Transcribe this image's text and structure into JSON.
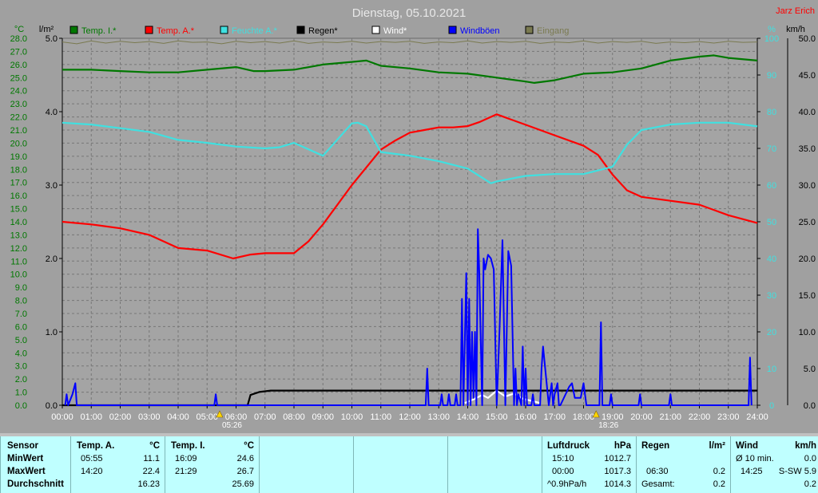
{
  "chart_data": {
    "type": "line",
    "title": "Dienstag, 05.10.2021",
    "author": "Jarz Erich",
    "axes": {
      "temp_unit": "°C",
      "temp_min": 0,
      "temp_max": 28,
      "rain_unit": "l/m²",
      "rain_min": 0,
      "rain_max": 5,
      "hum_unit": "%",
      "hum_min": 0,
      "hum_max": 100,
      "wind_unit": "km/h",
      "wind_min": 0,
      "wind_max": 50
    },
    "x_ticks": [
      "00:00",
      "01:00",
      "02:00",
      "03:00",
      "04:00",
      "05:00",
      "06:00",
      "07:00",
      "08:00",
      "09:00",
      "10:00",
      "11:00",
      "12:00",
      "13:00",
      "14:00",
      "15:00",
      "16:00",
      "17:00",
      "18:00",
      "19:00",
      "20:00",
      "21:00",
      "22:00",
      "23:00",
      "24:00"
    ],
    "temp_ticks": [
      "0.0",
      "1.0",
      "2.0",
      "3.0",
      "4.0",
      "5.0",
      "6.0",
      "7.0",
      "8.0",
      "9.0",
      "10.0",
      "11.0",
      "12.0",
      "13.0",
      "14.0",
      "15.0",
      "16.0",
      "17.0",
      "18.0",
      "19.0",
      "20.0",
      "21.0",
      "22.0",
      "23.0",
      "24.0",
      "25.0",
      "26.0",
      "27.0",
      "28.0"
    ],
    "rain_ticks": [
      "0.0",
      "1.0",
      "2.0",
      "3.0",
      "4.0",
      "5.0"
    ],
    "hum_ticks": [
      "0",
      "10",
      "20",
      "30",
      "40",
      "50",
      "60",
      "70",
      "80",
      "90",
      "100"
    ],
    "wind_ticks": [
      "0.0",
      "5.0",
      "10.0",
      "15.0",
      "20.0",
      "25.0",
      "30.0",
      "35.0",
      "40.0",
      "45.0",
      "50.0"
    ],
    "legend": [
      {
        "name": "Temp. I.*",
        "color": "#007800"
      },
      {
        "name": "Temp. A.*",
        "color": "#ff0000"
      },
      {
        "name": "Feuchte A.*",
        "color": "#40e0e0"
      },
      {
        "name": "Regen*",
        "color": "#000000"
      },
      {
        "name": "Wind*",
        "color": "#ffffff"
      },
      {
        "name": "Windböen",
        "color": "#0000ff"
      },
      {
        "name": "Eingang",
        "color": "#7a7a50"
      }
    ],
    "sunrise": "05:26",
    "sunset": "18:26",
    "series": [
      {
        "name": "Temp. I.*",
        "axis": "temp",
        "color": "#007800",
        "x": [
          0,
          1,
          2,
          3,
          4,
          5,
          6,
          6.6,
          7,
          8,
          9,
          10,
          10.5,
          11,
          12,
          13,
          14,
          15,
          16,
          16.3,
          17,
          18,
          19,
          20,
          21,
          22,
          22.5,
          23,
          24
        ],
        "y": [
          25.6,
          25.6,
          25.5,
          25.4,
          25.4,
          25.6,
          25.8,
          25.5,
          25.5,
          25.6,
          26.0,
          26.2,
          26.3,
          25.9,
          25.7,
          25.4,
          25.3,
          25.0,
          24.7,
          24.6,
          24.8,
          25.3,
          25.4,
          25.7,
          26.3,
          26.6,
          26.7,
          26.5,
          26.3
        ]
      },
      {
        "name": "Temp. A.*",
        "axis": "temp",
        "color": "#ff0000",
        "x": [
          0,
          1,
          2,
          3,
          4,
          5,
          5.9,
          6.5,
          7,
          8,
          8.5,
          9,
          10,
          11,
          11.5,
          12,
          12.5,
          13,
          13.5,
          14,
          14.4,
          15,
          15.5,
          16,
          17,
          18,
          18.5,
          19,
          19.5,
          20,
          21,
          22,
          23,
          24
        ],
        "y": [
          14.0,
          13.8,
          13.5,
          13.0,
          12.0,
          11.8,
          11.2,
          11.5,
          11.6,
          11.6,
          12.5,
          13.8,
          16.8,
          19.5,
          20.2,
          20.8,
          21.0,
          21.2,
          21.2,
          21.3,
          21.6,
          22.2,
          21.8,
          21.4,
          20.6,
          19.8,
          19.1,
          17.6,
          16.4,
          15.9,
          15.6,
          15.3,
          14.5,
          13.9
        ]
      },
      {
        "name": "Feuchte A.*",
        "axis": "hum",
        "color": "#40e0e0",
        "x": [
          0,
          1,
          2,
          3,
          4,
          5,
          6,
          7,
          7.5,
          8,
          9,
          10,
          10.2,
          10.5,
          11,
          12,
          13,
          14,
          14.8,
          15,
          16,
          17,
          18,
          19,
          19.5,
          20,
          21,
          22,
          23,
          24
        ],
        "y": [
          77,
          76.5,
          75.5,
          74.5,
          72.3,
          71.5,
          70.5,
          70,
          70.3,
          71.5,
          68,
          76.8,
          77,
          76,
          69,
          68,
          66.5,
          64.5,
          60.5,
          61,
          62.5,
          63,
          63,
          65,
          71,
          75,
          76.5,
          77,
          77,
          76
        ]
      },
      {
        "name": "Regen*",
        "axis": "rain",
        "color": "#000000",
        "x": [
          0,
          6.4,
          6.5,
          6.8,
          7.2,
          24
        ],
        "y": [
          0,
          0,
          0.14,
          0.18,
          0.2,
          0.2
        ]
      },
      {
        "name": "Wind*",
        "axis": "wind",
        "color": "#ffffff",
        "x": [
          13.9,
          14.2,
          14.5,
          14.7,
          15,
          15.3,
          15.6,
          15.9,
          16.2,
          16.5
        ],
        "y": [
          0.3,
          0.8,
          1.4,
          1.0,
          2.0,
          1.2,
          1.6,
          0.9,
          0.6,
          0.3
        ]
      },
      {
        "name": "Windböen",
        "axis": "wind",
        "color": "#0000ff",
        "x": [
          0.1,
          0.15,
          0.2,
          0.35,
          0.45,
          0.5,
          5.25,
          5.3,
          5.35,
          12.55,
          12.6,
          12.65,
          13.05,
          13.1,
          13.15,
          13.3,
          13.35,
          13.4,
          13.55,
          13.6,
          13.65,
          13.75,
          13.8,
          13.85,
          13.95,
          14.0,
          14.05,
          14.1,
          14.15,
          14.2,
          14.25,
          14.3,
          14.35,
          14.4,
          14.5,
          14.55,
          14.6,
          14.7,
          14.8,
          14.9,
          15.0,
          15.1,
          15.2,
          15.3,
          15.4,
          15.5,
          15.6,
          15.65,
          15.7,
          15.75,
          15.85,
          15.9,
          15.95,
          16.0,
          16.05,
          16.1,
          16.2,
          16.25,
          16.3,
          16.5,
          16.55,
          16.6,
          16.8,
          16.85,
          16.9,
          16.95,
          17.0,
          17.1,
          17.15,
          17.2,
          17.5,
          17.6,
          17.7,
          17.9,
          18.0,
          18.1,
          18.55,
          18.6,
          18.65,
          18.9,
          18.95,
          19.0,
          19.9,
          19.95,
          20.0,
          20.95,
          21.0,
          21.05,
          23.7,
          23.75,
          23.8
        ],
        "y": [
          0,
          1.5,
          0,
          1.5,
          3.0,
          0,
          0,
          1.5,
          0,
          0,
          5.0,
          0,
          0,
          1.5,
          0,
          0,
          1.5,
          0,
          0,
          1.5,
          0,
          0,
          14.5,
          0,
          18.0,
          0,
          14.5,
          0,
          10.0,
          1.0,
          10.0,
          0,
          24.0,
          18.0,
          0,
          20.0,
          18.5,
          20.5,
          20.0,
          18.5,
          0,
          10.5,
          22.5,
          0,
          21.0,
          19.0,
          0,
          5.0,
          0,
          1.5,
          0,
          8.0,
          0,
          5.0,
          0,
          0,
          0,
          1.5,
          0,
          0,
          5.0,
          8.0,
          0,
          1.5,
          3.0,
          0,
          1.5,
          3.0,
          0,
          0,
          2.5,
          3.0,
          1.0,
          1.0,
          3.0,
          0,
          0,
          11.3,
          0,
          0,
          1.5,
          0,
          0,
          1.5,
          0,
          0,
          1.5,
          0,
          0,
          6.5,
          0
        ]
      },
      {
        "name": "Eingang",
        "axis": "hum",
        "color": "#7a7a50",
        "x": [
          0,
          0.5,
          1,
          1.5,
          2,
          2.5,
          3,
          3.5,
          4,
          4.5,
          5,
          5.5,
          6,
          6.5,
          7,
          7.5,
          8,
          8.5,
          9,
          9.5,
          10,
          10.5,
          11,
          11.5,
          12,
          12.5,
          13,
          13.5,
          14,
          14.5,
          15,
          15.5,
          16,
          16.5,
          17,
          17.5,
          18,
          18.5,
          19,
          19.5,
          20,
          20.5,
          21,
          21.5,
          22,
          22.5,
          23,
          23.5,
          24
        ],
        "y": [
          99,
          98.5,
          99.3,
          98.7,
          99.2,
          98.8,
          99.1,
          98.6,
          99.3,
          98.9,
          99,
          98.5,
          99.2,
          98.8,
          99.1,
          98.7,
          99.3,
          98.6,
          99,
          98.8,
          99.2,
          98.7,
          99.1,
          98.9,
          99.2,
          98.6,
          99,
          98.8,
          99.3,
          98.7,
          99.1,
          98.9,
          99.2,
          98.6,
          99,
          98.8,
          99.3,
          98.7,
          99.1,
          98.9,
          99.2,
          98.6,
          99,
          98.8,
          99.1,
          98.7,
          99.2,
          98.9,
          99
        ]
      }
    ]
  },
  "stats": {
    "sensor": {
      "header": "Sensor",
      "rows": [
        "MinWert",
        "MaxWert",
        "Durchschnitt"
      ]
    },
    "temp_a": {
      "header": "Temp. A.",
      "unit": "°C",
      "min_time": "05:55",
      "min_val": "11.1",
      "max_time": "14:20",
      "max_val": "22.4",
      "avg": "16.23"
    },
    "temp_i": {
      "header": "Temp. I.",
      "unit": "°C",
      "min_time": "16:09",
      "min_val": "24.6",
      "max_time": "21:29",
      "max_val": "26.7",
      "avg": "25.69"
    },
    "pressure": {
      "header": "Luftdruck",
      "unit": "hPa",
      "min_time": "15:10",
      "min_val": "1012.7",
      "max_time": "00:00",
      "max_val": "1017.3",
      "trend": "^0.9hPa/h",
      "cur": "1014.3"
    },
    "rain": {
      "header": "Regen",
      "unit": "l/m²",
      "max_time": "06:30",
      "max_val": "0.2",
      "total_label": "Gesamt:",
      "total": "0.2"
    },
    "wind": {
      "header": "Wind",
      "unit": "km/h",
      "avg_label": "Ø 10 min.",
      "avg": "0.0",
      "max_time": "14:25",
      "max_dir": "S-SW 5.9",
      "last": "0.2"
    }
  }
}
